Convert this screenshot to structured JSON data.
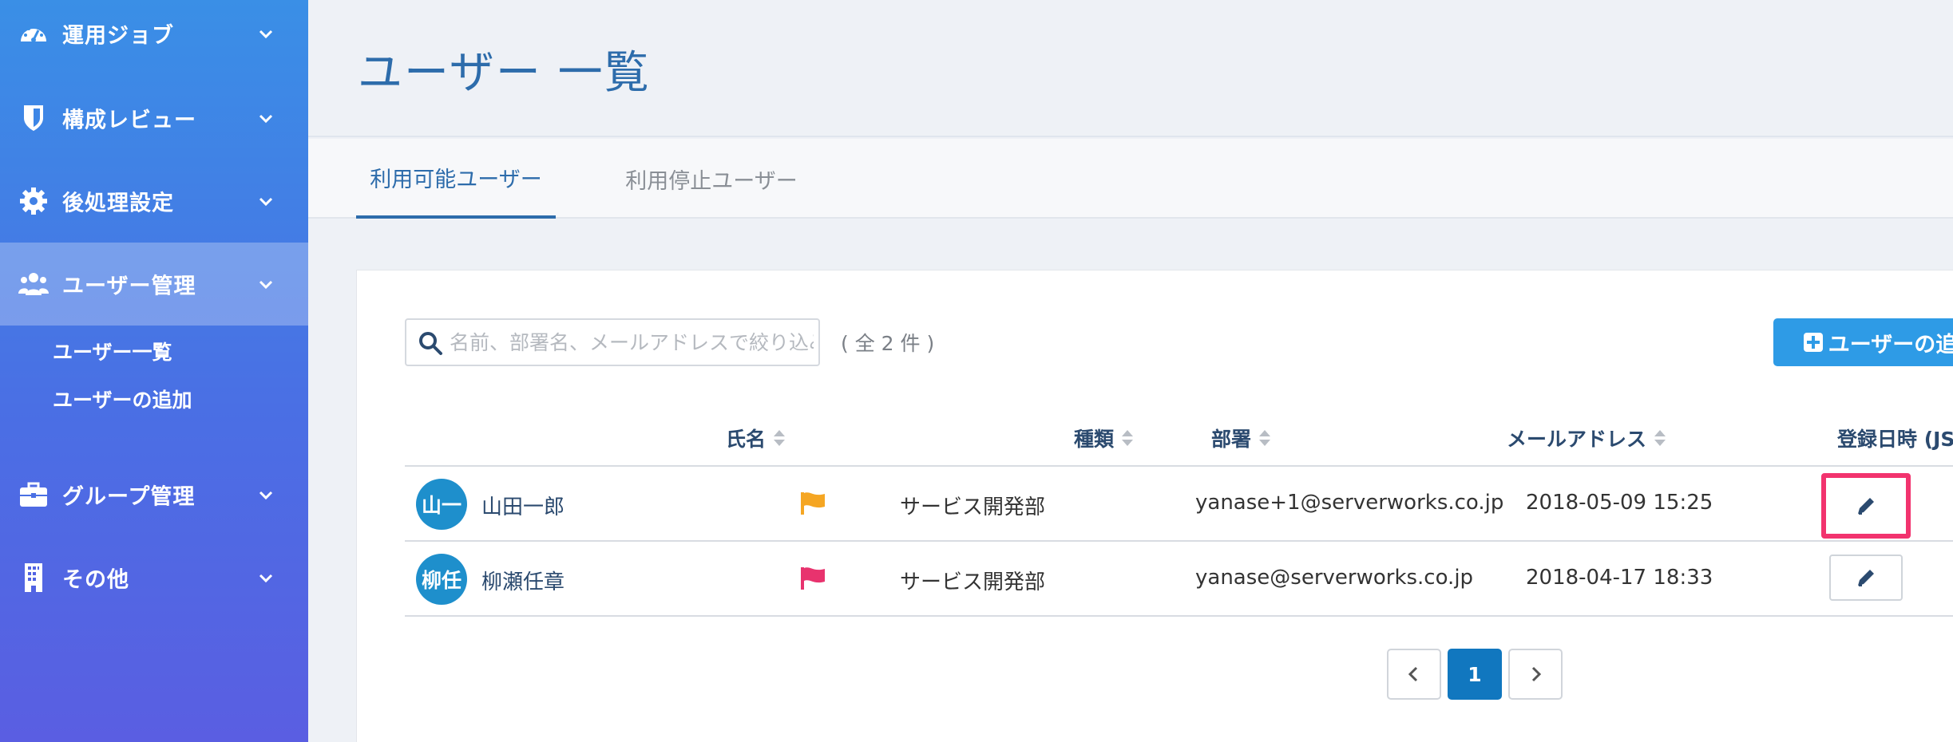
{
  "sidebar": {
    "items": [
      {
        "label": "運用ジョブ",
        "icon": "dashboard-icon"
      },
      {
        "label": "構成レビュー",
        "icon": "shield-icon"
      },
      {
        "label": "後処理設定",
        "icon": "gear-icon"
      },
      {
        "label": "ユーザー管理",
        "icon": "users-icon"
      },
      {
        "label": "グループ管理",
        "icon": "briefcase-icon"
      },
      {
        "label": "その他",
        "icon": "building-icon"
      }
    ],
    "sub_items": [
      {
        "label": "ユーザー一覧"
      },
      {
        "label": "ユーザーの追加"
      }
    ]
  },
  "header": {
    "title": "ユーザー 一覧"
  },
  "tabs": [
    {
      "label": "利用可能ユーザー",
      "active": true
    },
    {
      "label": "利用停止ユーザー",
      "active": false
    }
  ],
  "toolbar": {
    "search_placeholder": "名前、部署名、メールアドレスで絞り込み",
    "count": "( 全 2 件 )",
    "add_label": "ユーザーの追加"
  },
  "table": {
    "columns": [
      "氏名",
      "種類",
      "部署",
      "メールアドレス",
      "登録日時 (JST)"
    ],
    "rows": [
      {
        "avatar": "山一",
        "name": "山田一郎",
        "flag_color": "#f5a623",
        "dept": "サービス開発部",
        "email": "yanase+1@serverworks.co.jp",
        "date": "2018-05-09 15:25"
      },
      {
        "avatar": "柳任",
        "name": "柳瀬任章",
        "flag_color": "#e8336e",
        "dept": "サービス開発部",
        "email": "yanase@serverworks.co.jp",
        "date": "2018-04-17 18:33"
      }
    ]
  },
  "pagination": {
    "current": "1"
  },
  "colors": {
    "accent": "#2d6cab",
    "button": "#2e9be6",
    "highlight": "#f2336e"
  }
}
